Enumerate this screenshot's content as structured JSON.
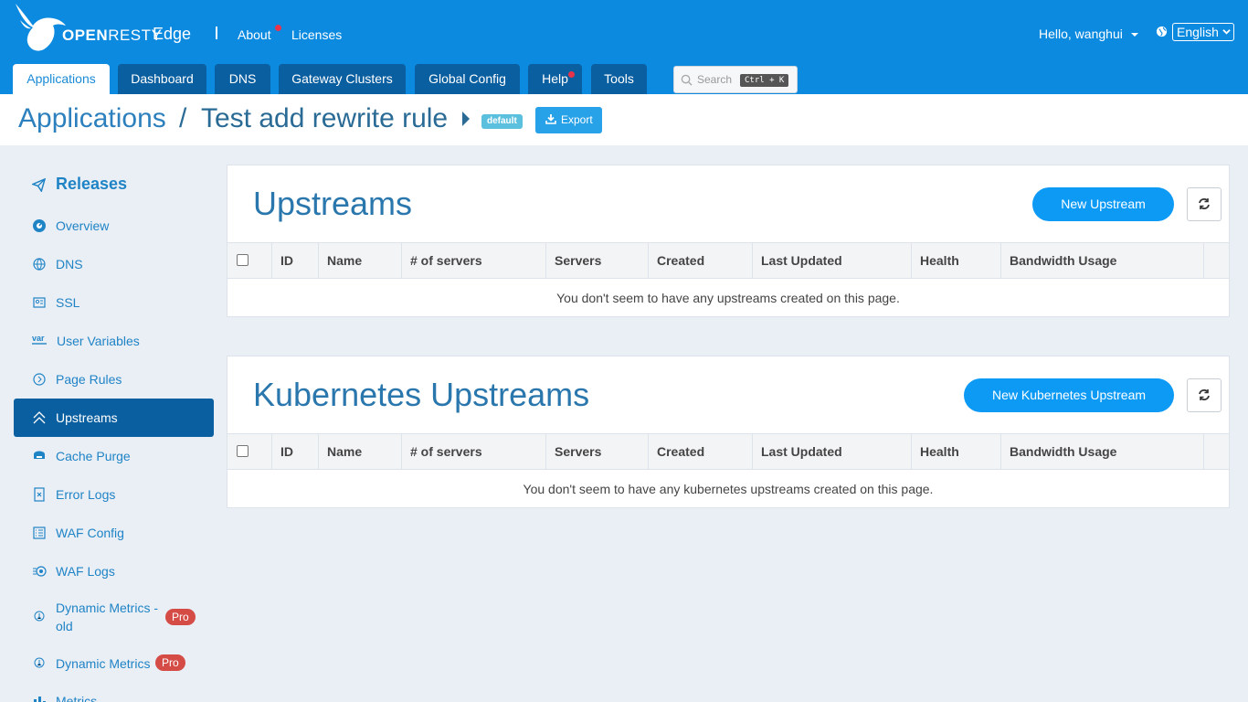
{
  "header": {
    "brand": {
      "strong": "OPEN",
      "thin": "RESTY",
      "product": "Edge"
    },
    "links": [
      {
        "label": "About"
      },
      {
        "label": "Licenses"
      }
    ],
    "user": "Hello, wanghui",
    "language": "English"
  },
  "tabs": [
    {
      "label": "Applications"
    },
    {
      "label": "Dashboard"
    },
    {
      "label": "DNS"
    },
    {
      "label": "Gateway Clusters"
    },
    {
      "label": "Global Config"
    },
    {
      "label": "Help"
    },
    {
      "label": "Tools"
    }
  ],
  "search": {
    "placeholder": "Search",
    "shortcut": "Ctrl + K"
  },
  "breadcrumb": {
    "root": "Applications",
    "separator": "/",
    "current": "Test add rewrite rule",
    "badge": "default",
    "export_label": "Export"
  },
  "sidebar": {
    "heading": "Releases",
    "items": [
      {
        "label": "Overview",
        "icon": "dashboard-icon"
      },
      {
        "label": "DNS",
        "icon": "globe-icon"
      },
      {
        "label": "SSL",
        "icon": "certificate-icon"
      },
      {
        "label": "User Variables",
        "icon": "var-icon"
      },
      {
        "label": "Page Rules",
        "icon": "page-rules-icon"
      },
      {
        "label": "Upstreams",
        "icon": "upstreams-icon"
      },
      {
        "label": "Cache Purge",
        "icon": "cache-icon"
      },
      {
        "label": "Error Logs",
        "icon": "error-logs-icon"
      },
      {
        "label": "WAF Config",
        "icon": "list-icon"
      },
      {
        "label": "WAF Logs",
        "icon": "waf-logs-icon"
      },
      {
        "label": "Dynamic Metrics - old",
        "line1": "Dynamic Metrics -",
        "line2": "old",
        "icon": "pin-icon",
        "badge": "Pro"
      },
      {
        "label": "Dynamic Metrics",
        "icon": "pin-icon",
        "badge": "Pro"
      },
      {
        "label": "Metrics",
        "icon": "bar-chart-icon"
      }
    ]
  },
  "upstreams": {
    "title": "Upstreams",
    "new_button": "New Upstream",
    "columns": [
      "ID",
      "Name",
      "# of servers",
      "Servers",
      "Created",
      "Last Updated",
      "Health",
      "Bandwidth Usage"
    ],
    "empty_message": "You don't seem to have any upstreams created on this page."
  },
  "k8s_upstreams": {
    "title": "Kubernetes Upstreams",
    "new_button": "New Kubernetes Upstream",
    "columns": [
      "ID",
      "Name",
      "# of servers",
      "Servers",
      "Created",
      "Last Updated",
      "Health",
      "Bandwidth Usage"
    ],
    "empty_message": "You don't seem to have any kubernetes upstreams created on this page."
  },
  "colors": {
    "header_bg": "#0c8ae0",
    "tab_bg": "#0a5fa0",
    "accent": "#0d9af5",
    "pro_badge": "#d54b45"
  }
}
